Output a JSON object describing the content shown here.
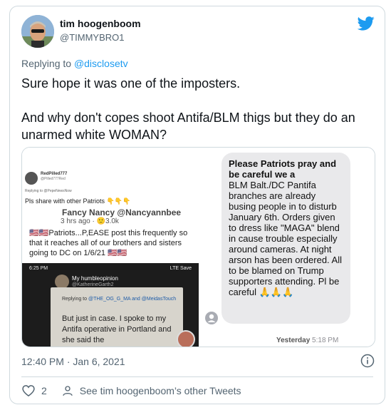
{
  "author": {
    "name": "tim hoogenboom",
    "handle": "@TIMMYBRO1"
  },
  "replying": {
    "prefix": "Replying to",
    "mention": "@disclosetv"
  },
  "tweet": {
    "line1": "Sure hope it was one of the imposters.",
    "line2": "And why don't copes shoot Antifa/BLM thigs but they do an unarmed white WOMAN?"
  },
  "left_image": {
    "fb_user": "RedPilled777",
    "fb_user_handle": "@Pilled777Red",
    "fb_reply": "Replying to @PepeNewsNow",
    "fb_share": "Pls share with other Patriots 👇👇👇",
    "poster_name": "Fancy Nancy @Nancyannbee",
    "poster_time": "3 hrs ago · 🙂3.0k",
    "poster_text": "🇺🇸🇺🇸Patriots...P,EASE post this frequently so that it reaches all of our brothers and sisters going to DC on 1/6/21 🇺🇸🇺🇸",
    "phone_time": "6:25 PM",
    "phone_right": "LTE Save",
    "inner_name": "My humbleopinion",
    "inner_handle": "@KatherineGarth2",
    "inner_reply_prefix": "Replying to ",
    "inner_reply_mention": "@THE_OG_G_MA and @MeidasTouch",
    "inner_text": "But just in case. I spoke to my Antifa operative in Portland and she said the"
  },
  "right_image": {
    "bold_text": "Please Patriots pray and be careful we a",
    "body_text": "BLM Balt./DC Pantifa branches are already busing people in to disturb January 6th. Orders given to dress like \"MAGA\" blend in cause trouble especially around cameras. At night arson has been ordered. All to be blamed on Trump supporters attending. Pl be careful 🙏🙏🙏",
    "stamp_day": "Yesterday",
    "stamp_time": "5:18 PM"
  },
  "meta": {
    "timestamp": "12:40 PM · Jan 6, 2021",
    "like_count": "2",
    "other_tweets": "See tim hoogenboom’s other Tweets"
  },
  "colors": {
    "twitter_blue": "#1d9bf0",
    "secondary_text": "#536471",
    "border": "#cfd9de"
  },
  "icons": {
    "brand": "twitter-bird-icon",
    "info": "info-circle-icon",
    "like": "heart-icon",
    "profile": "person-icon"
  }
}
